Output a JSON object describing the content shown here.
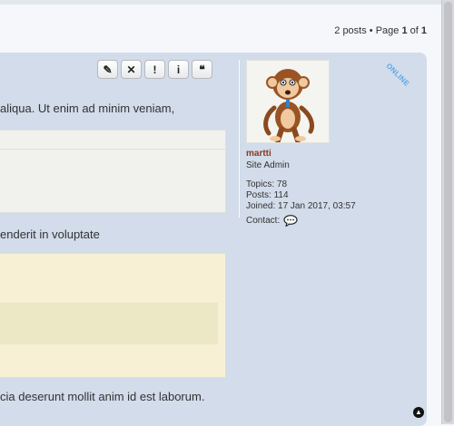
{
  "pagination": {
    "prefix": "2 posts • Page ",
    "current": "1",
    "mid": " of ",
    "total": "1"
  },
  "post": {
    "buttons": [
      {
        "name": "edit",
        "glyph": "✎"
      },
      {
        "name": "delete",
        "glyph": "✕"
      },
      {
        "name": "report",
        "glyph": "!"
      },
      {
        "name": "info",
        "glyph": "i"
      },
      {
        "name": "quote",
        "glyph": "❝"
      }
    ],
    "lines": [
      "aliqua. Ut enim ad minim veniam,",
      "enderit in voluptate",
      "cia deserunt mollit anim id est laborum."
    ],
    "online_label": "ONLINE"
  },
  "profile": {
    "username": "martti",
    "rank": "Site Admin",
    "topics": "Topics: 78",
    "posts": "Posts: 114",
    "joined": "Joined: 17 Jan 2017, 03:57",
    "contact": "Contact:"
  },
  "icons": {
    "back_to_top": "chevron-up-icon",
    "contact": "speech-bubble-icon"
  }
}
